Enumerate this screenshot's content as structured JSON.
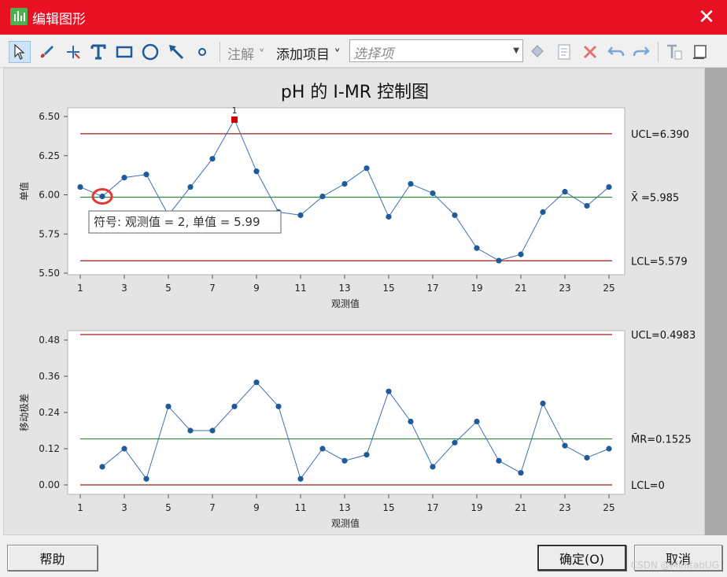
{
  "window": {
    "title": "编辑图形",
    "close_label": "✕"
  },
  "toolbar": {
    "tools": [
      {
        "id": "select",
        "icon": "select-arrow-icon"
      },
      {
        "id": "brush",
        "icon": "brush-icon"
      },
      {
        "id": "crosshair",
        "icon": "crosshair-icon"
      },
      {
        "id": "text",
        "icon": "text-tool-icon",
        "glyph": "T"
      },
      {
        "id": "rect",
        "icon": "rectangle-icon"
      },
      {
        "id": "ellipse",
        "icon": "ellipse-icon"
      },
      {
        "id": "line",
        "icon": "arrow-line-icon"
      },
      {
        "id": "point",
        "icon": "point-icon"
      }
    ],
    "annotate_label": "注解",
    "add_item_label": "添加项目",
    "select_placeholder": "选择项"
  },
  "chart_title": "pH 的 I-MR 控制图",
  "chart_data": [
    {
      "type": "line",
      "name": "individual",
      "ylabel": "单值",
      "xlabel": "观测值",
      "xlim": [
        1,
        25
      ],
      "ylim": [
        5.5,
        6.5
      ],
      "yticks": [
        "6.50",
        "6.25",
        "6.00",
        "5.75",
        "5.50"
      ],
      "ytick_values": [
        6.5,
        6.25,
        6.0,
        5.75,
        5.5
      ],
      "xticks": [
        1,
        3,
        5,
        7,
        9,
        11,
        13,
        15,
        17,
        19,
        21,
        23,
        25
      ],
      "x": [
        1,
        2,
        3,
        4,
        5,
        6,
        7,
        8,
        9,
        10,
        11,
        12,
        13,
        14,
        15,
        16,
        17,
        18,
        19,
        20,
        21,
        22,
        23,
        24,
        25
      ],
      "values": [
        6.05,
        5.99,
        6.11,
        6.13,
        5.87,
        6.05,
        6.23,
        6.48,
        6.15,
        5.89,
        5.87,
        5.99,
        6.07,
        6.17,
        5.86,
        6.07,
        6.01,
        5.87,
        5.66,
        5.58,
        5.62,
        5.89,
        6.02,
        5.93,
        6.05
      ],
      "limits": {
        "ucl": 6.39,
        "center": 5.985,
        "lcl": 5.579
      },
      "limit_labels": {
        "ucl": "UCL=6.390",
        "center": "X̄ =5.985",
        "lcl": "LCL=5.579"
      },
      "out_of_control": [
        {
          "x": 8,
          "label": "1"
        }
      ],
      "tooltip": "符号:  观测值 = 2, 单值 = 5.99",
      "highlight_x": 2
    },
    {
      "type": "line",
      "name": "moving-range",
      "ylabel": "移动极差",
      "xlabel": "观测值",
      "xlim": [
        1,
        25
      ],
      "ylim": [
        0,
        0.5
      ],
      "yticks": [
        "0.48",
        "0.36",
        "0.24",
        "0.12",
        "0.00"
      ],
      "ytick_values": [
        0.48,
        0.36,
        0.24,
        0.12,
        0.0
      ],
      "xticks": [
        1,
        3,
        5,
        7,
        9,
        11,
        13,
        15,
        17,
        19,
        21,
        23,
        25
      ],
      "x": [
        2,
        3,
        4,
        5,
        6,
        7,
        8,
        9,
        10,
        11,
        12,
        13,
        14,
        15,
        16,
        17,
        18,
        19,
        20,
        21,
        22,
        23,
        24,
        25
      ],
      "values": [
        0.06,
        0.12,
        0.02,
        0.26,
        0.18,
        0.18,
        0.26,
        0.34,
        0.26,
        0.02,
        0.12,
        0.08,
        0.1,
        0.31,
        0.21,
        0.06,
        0.14,
        0.21,
        0.08,
        0.04,
        0.27,
        0.13,
        0.09,
        0.12
      ],
      "limits": {
        "ucl": 0.4983,
        "center": 0.1525,
        "lcl": 0
      },
      "limit_labels": {
        "ucl": "UCL=0.4983",
        "center": "M̄R=0.1525",
        "lcl": "LCL=0"
      }
    }
  ],
  "colors": {
    "point": "#1f5a99",
    "line": "#3a6fb0",
    "limit": "#9b1c1c",
    "center": "#2e8b3e",
    "ooc": "#d40000",
    "highlight": "#e53935"
  },
  "footer": {
    "help_label": "帮助",
    "ok_label": "确定(O)",
    "cancel_label": "取消",
    "watermark": "CSDN @MinitabUG"
  }
}
